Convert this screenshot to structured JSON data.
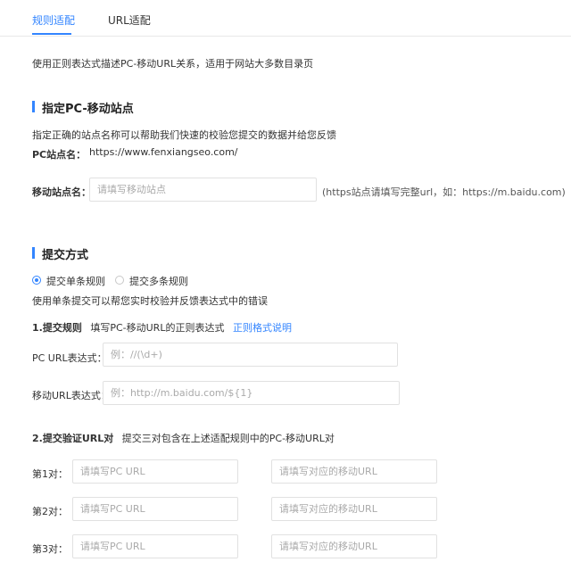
{
  "tabs": [
    {
      "label": "规则适配",
      "active": true
    },
    {
      "label": "URL适配",
      "active": false
    }
  ],
  "intro": "使用正则表达式描述PC-移动URL关系，适用于网站大多数目录页",
  "site_section": {
    "title": "指定PC-移动站点",
    "description": "指定正确的站点名称可以帮助我们快速的校验您提交的数据并给您反馈",
    "pc_label": "PC站点名：",
    "pc_value": "https://www.fenxiangseo.com/",
    "mobile_label": "移动站点名：",
    "mobile_placeholder": "请填写移动站点",
    "mobile_hint": "(https站点请填写完整url，如：https://m.baidu.com)"
  },
  "submit_section": {
    "title": "提交方式",
    "options": [
      {
        "label": "提交单条规则",
        "checked": true
      },
      {
        "label": "提交多条规则",
        "checked": false
      }
    ],
    "note": "使用单条提交可以帮您实时校验并反馈表达式中的错误",
    "step1": {
      "title": "1.提交规则",
      "hint": "填写PC-移动URL的正则表达式",
      "link": "正则格式说明",
      "pc_label": "PC  URL表达式：",
      "pc_placeholder": "例：//(\\d+)",
      "mobile_label": "移动URL表达式：",
      "mobile_placeholder": "例：http://m.baidu.com/${1}"
    },
    "step2": {
      "title": "2.提交验证URL对",
      "hint": "提交三对包含在上述适配规则中的PC-移动URL对",
      "pairs": [
        {
          "label": "第1对：",
          "pc_placeholder": "请填写PC URL",
          "mobile_placeholder": "请填写对应的移动URL"
        },
        {
          "label": "第2对：",
          "pc_placeholder": "请填写PC URL",
          "mobile_placeholder": "请填写对应的移动URL"
        },
        {
          "label": "第3对：",
          "pc_placeholder": "请填写PC URL",
          "mobile_placeholder": "请填写对应的移动URL"
        }
      ]
    }
  },
  "colors": {
    "accent": "#3385ff",
    "border": "#e1e1e1",
    "text": "#333333"
  }
}
